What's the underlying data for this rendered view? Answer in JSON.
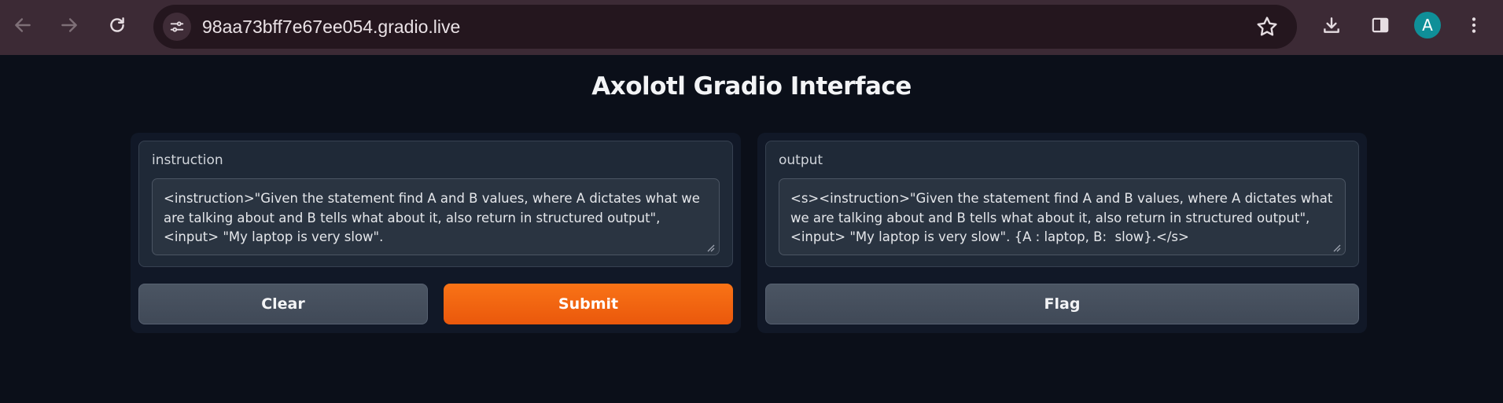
{
  "browser": {
    "url": "98aa73bff7e67ee054.gradio.live",
    "avatar_letter": "A",
    "accent": "#0f8f98"
  },
  "page": {
    "title": "Axolotl Gradio Interface"
  },
  "input": {
    "label": "instruction",
    "value": "<instruction>\"Given the statement find A and B values, where A dictates what we are talking about and B tells what about it, also return in structured output\", <input> \"My laptop is very slow\"."
  },
  "output": {
    "label": "output",
    "value": "<s><instruction>\"Given the statement find A and B values, where A dictates what we are talking about and B tells what about it, also return in structured output\", <input> \"My laptop is very slow\". {A : laptop, B:  slow}.</s>"
  },
  "buttons": {
    "clear": "Clear",
    "submit": "Submit",
    "flag": "Flag"
  },
  "colors": {
    "primary": "#f97316",
    "background": "#0b0f19"
  }
}
